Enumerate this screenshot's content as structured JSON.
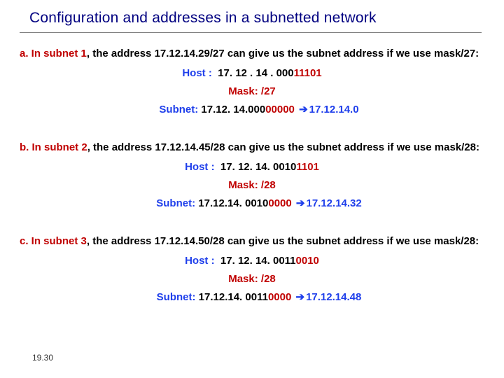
{
  "title": "Configuration and addresses in a subnetted network",
  "pagenum": "19.30",
  "blocks": [
    {
      "lead_label": "a. In subnet 1",
      "lead_comma": ",",
      "intro_pre": " the address ",
      "intro_addr": "17.12.14.29/27",
      "intro_mid": " can give us the subnet address if we use ",
      "intro_mask": "mask/27:",
      "host_label": "Host :",
      "host_pre": "17. 12 . 14 . 000",
      "host_red": "11101",
      "mask_label": "Mask:",
      "mask_val": "/27",
      "subnet_label": "Subnet:",
      "subnet_pre": "17.12. 14.000",
      "subnet_red": "00000",
      "subnet_result": "17.12.14.0"
    },
    {
      "lead_label": "b. In subnet 2",
      "lead_comma": ",",
      "intro_pre": " the address ",
      "intro_addr": "17.12.14.45/28",
      "intro_mid": " can give us the subnet address if we use ",
      "intro_mask": "mask/28:",
      "host_label": "Host :",
      "host_pre": "17. 12. 14. 0010",
      "host_red": "1101",
      "mask_label": "Mask:",
      "mask_val": "/28",
      "subnet_label": "Subnet:",
      "subnet_pre": "17.12.14. 0010",
      "subnet_red": "0000",
      "subnet_result": "17.12.14.32"
    },
    {
      "lead_label": "c. In subnet 3",
      "lead_comma": ",",
      "intro_pre": " the address ",
      "intro_addr": "17.12.14.50/28",
      "intro_mid": " can give us the subnet address if we use ",
      "intro_mask": "mask/28:",
      "host_label": "Host :",
      "host_pre": "17. 12. 14. 0011",
      "host_red": "0010",
      "mask_label": "Mask:",
      "mask_val": "/28",
      "subnet_label": "Subnet:",
      "subnet_pre": "17.12.14. 0011",
      "subnet_red": "0000",
      "subnet_result": "17.12.14.48"
    }
  ],
  "arrow_glyph": "➔"
}
